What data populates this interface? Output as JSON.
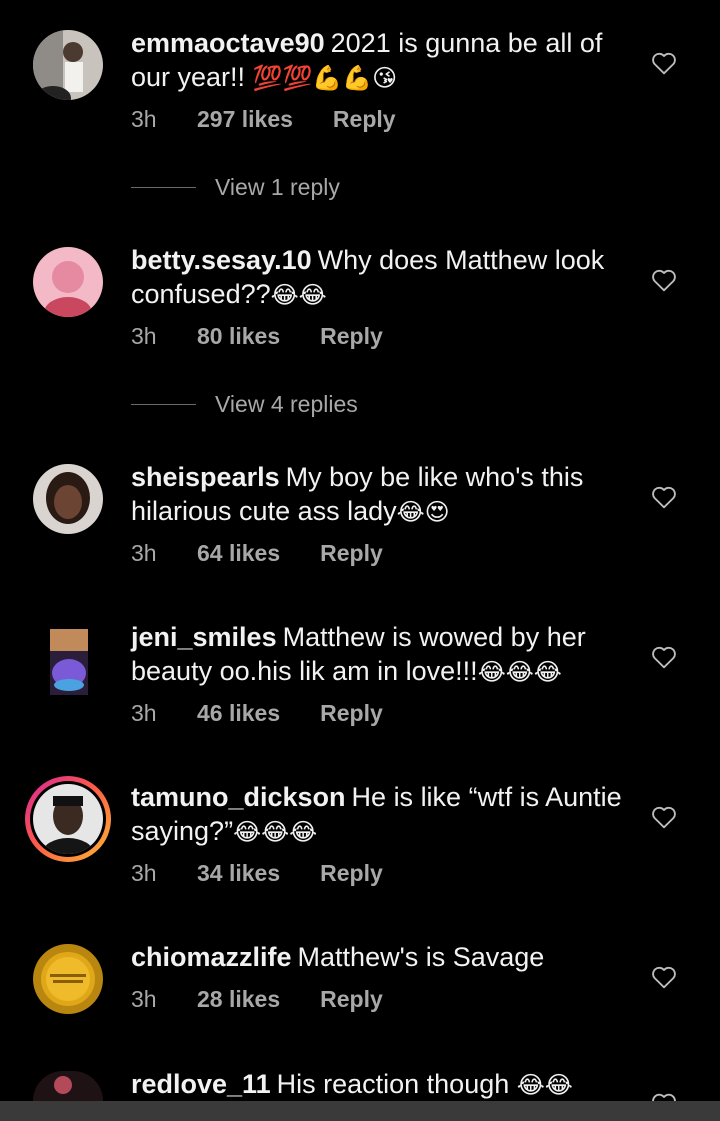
{
  "colors": {
    "background": "#000000",
    "text": "#f2f2f2",
    "muted": "#a8a8a8",
    "story_ring": "#fd5949"
  },
  "comments": [
    {
      "username": "emmaoctave90",
      "text": "2021 is gunna be all of our year!!",
      "emoji": "💯💯💪💪😘",
      "time": "3h",
      "likes": "297 likes",
      "reply": "Reply",
      "view_replies": "View 1 reply"
    },
    {
      "username": "betty.sesay.10",
      "text": "Why does Matthew look confused??",
      "emoji": "😂😂",
      "time": "3h",
      "likes": "80 likes",
      "reply": "Reply",
      "view_replies": "View 4 replies"
    },
    {
      "username": "sheispearls",
      "text": "My boy be like who's this hilarious cute ass lady",
      "emoji": "😂😍",
      "time": "3h",
      "likes": "64 likes",
      "reply": "Reply"
    },
    {
      "username": "jeni_smiles",
      "text": "Matthew is wowed by her beauty oo.his lik am in love!!!",
      "emoji": "😂😂😂",
      "time": "3h",
      "likes": "46 likes",
      "reply": "Reply"
    },
    {
      "username": "tamuno_dickson",
      "text": "He is like “wtf is Auntie saying?”",
      "emoji": "😂😂😂",
      "time": "3h",
      "likes": "34 likes",
      "reply": "Reply"
    },
    {
      "username": "chiomazzlife",
      "text": "Matthew's is Savage",
      "emoji": "",
      "time": "3h",
      "likes": "28 likes",
      "reply": "Reply"
    },
    {
      "username": "redlove_11",
      "text": "His reaction though",
      "emoji": "😂😂",
      "time": "",
      "likes": "",
      "reply": ""
    }
  ],
  "icons": {
    "like": "heart-outline-icon"
  }
}
